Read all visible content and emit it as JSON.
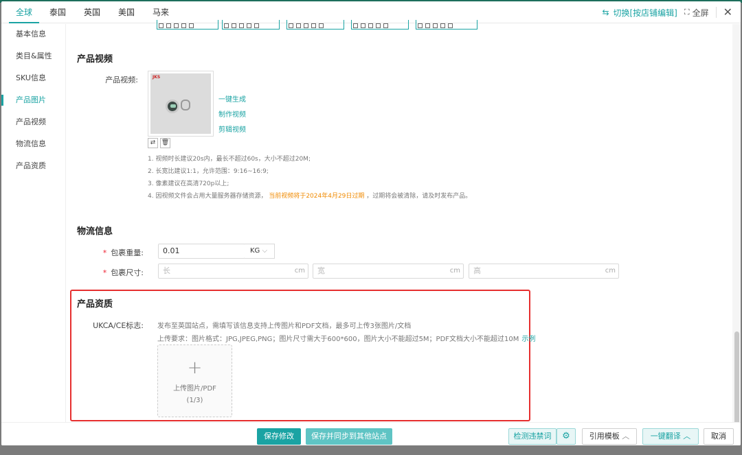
{
  "tabs": [
    {
      "label": "全球",
      "active": true
    },
    {
      "label": "泰国",
      "active": false
    },
    {
      "label": "英国",
      "active": false
    },
    {
      "label": "美国",
      "active": false
    },
    {
      "label": "马来",
      "active": false
    }
  ],
  "header": {
    "switch_label": "切换[按店铺编辑]",
    "fullscreen_label": "全屏",
    "close_icon": "close-icon"
  },
  "sidebar": {
    "items": [
      {
        "label": "基本信息"
      },
      {
        "label": "类目&属性"
      },
      {
        "label": "SKU信息"
      },
      {
        "label": "产品图片",
        "active": true
      },
      {
        "label": "产品视频"
      },
      {
        "label": "物流信息"
      },
      {
        "label": "产品资质"
      }
    ]
  },
  "video": {
    "title": "产品视频",
    "label": "产品视频:",
    "actions": [
      "一键生成",
      "制作视频",
      "剪辑视频"
    ],
    "notes": {
      "n1": "1. 视频时长建议20s内，最长不超过60s，大小不超过20M;",
      "n2": "2. 长宽比建议1:1，允许范围：9:16~16:9;",
      "n3": "3. 像素建议在高清720p以上;",
      "n4_prefix": "4. 因视频文件会占用大量服务器存储资源，",
      "n4_warning": "当前视频将于2024年4月29日过期",
      "n4_suffix": "，过期将会被清除，请及时发布产品。"
    }
  },
  "logistics": {
    "title": "物流信息",
    "weight_label": "包裹重量:",
    "weight_value": "0.01",
    "weight_unit": "KG",
    "size_label": "包裹尺寸:",
    "length_placeholder": "长",
    "width_placeholder": "宽",
    "height_placeholder": "高",
    "size_unit": "cm"
  },
  "qualification": {
    "title": "产品资质",
    "label": "UKCA/CE标志:",
    "hint1": "发布至英国站点，需填写该信息支持上传图片和PDF文档，最多可上传3张图片/文档",
    "hint2": "上传要求：图片格式：JPG,JPEG,PNG；图片尺寸需大于600*600，图片大小不能超过5M；PDF文档大小不能超过10M",
    "example_link": "示例",
    "upload_label": "上传图片/PDF",
    "upload_count": "(1/3)"
  },
  "footer": {
    "save": "保存修改",
    "save_sync": "保存并同步到其他站点",
    "check_words": "检测违禁词",
    "template": "引用模板",
    "translate": "一键翻译",
    "cancel": "取消"
  },
  "colors": {
    "accent": "#1aa3a3",
    "warning": "#f08a00",
    "highlight_box": "#e62e2e"
  }
}
